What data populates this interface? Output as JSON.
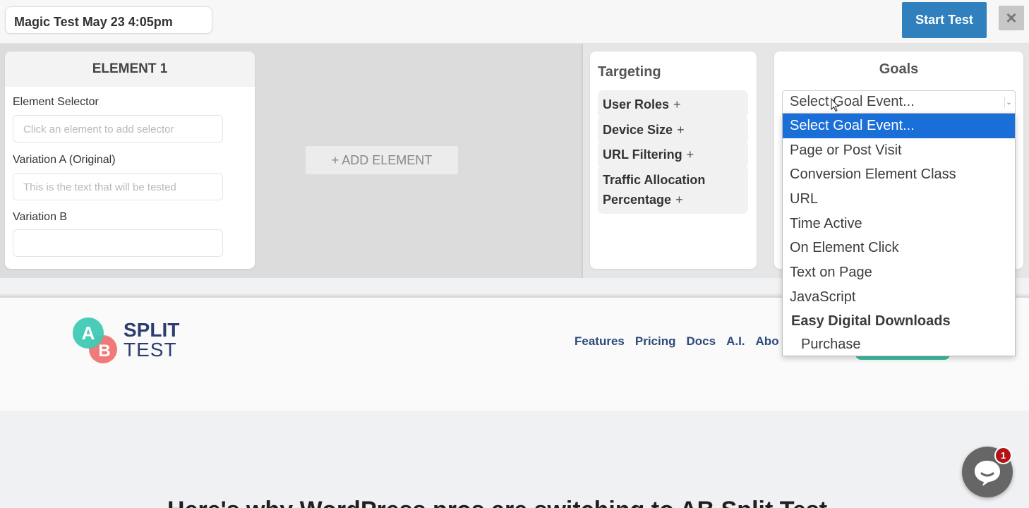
{
  "topbar": {
    "test_name": "Magic Test May 23 4:05pm",
    "start_label": "Start Test",
    "close_glyph": "×"
  },
  "element_card": {
    "title": "ELEMENT 1",
    "selector_label": "Element Selector",
    "selector_placeholder": "Click an element to add selector",
    "variation_a_label": "Variation A (Original)",
    "variation_a_placeholder": "This is the text that will be tested",
    "variation_b_label": "Variation B",
    "variation_b_value": ""
  },
  "add_element_label": "+ ADD ELEMENT",
  "targeting": {
    "title": "Targeting",
    "items": [
      {
        "label": "User Roles",
        "plus": "+"
      },
      {
        "label": "Device Size",
        "plus": "+"
      },
      {
        "label": "URL Filtering",
        "plus": "+"
      },
      {
        "label": "Traffic Allocation Percentage",
        "plus": "+"
      }
    ]
  },
  "goals": {
    "title": "Goals",
    "selected": "Select Goal Event...",
    "options": [
      "Select Goal Event...",
      "Page or Post Visit",
      "Conversion Element Class",
      "URL",
      "Time Active",
      "On Element Click",
      "Text on Page",
      "JavaScript"
    ],
    "group_label": "Easy Digital Downloads",
    "group_options": [
      "Purchase"
    ]
  },
  "site": {
    "logo_a": "A",
    "logo_b": "B",
    "logo_split": "SPLIT",
    "logo_test": "TEST",
    "nav": [
      "Features",
      "Pricing",
      "Docs",
      "A.I.",
      "Abo"
    ],
    "hero_title": "Here's why WordPress pros are switching to AB Split Test"
  },
  "chat": {
    "badge_count": "1"
  },
  "colors": {
    "primary_button": "#2f80bd",
    "dropdown_highlight": "#1a6ed8",
    "logo_teal": "#3fc9b4",
    "logo_coral": "#f07a7a",
    "brand_navy": "#2d3d72",
    "chat_badge": "#b31217"
  }
}
